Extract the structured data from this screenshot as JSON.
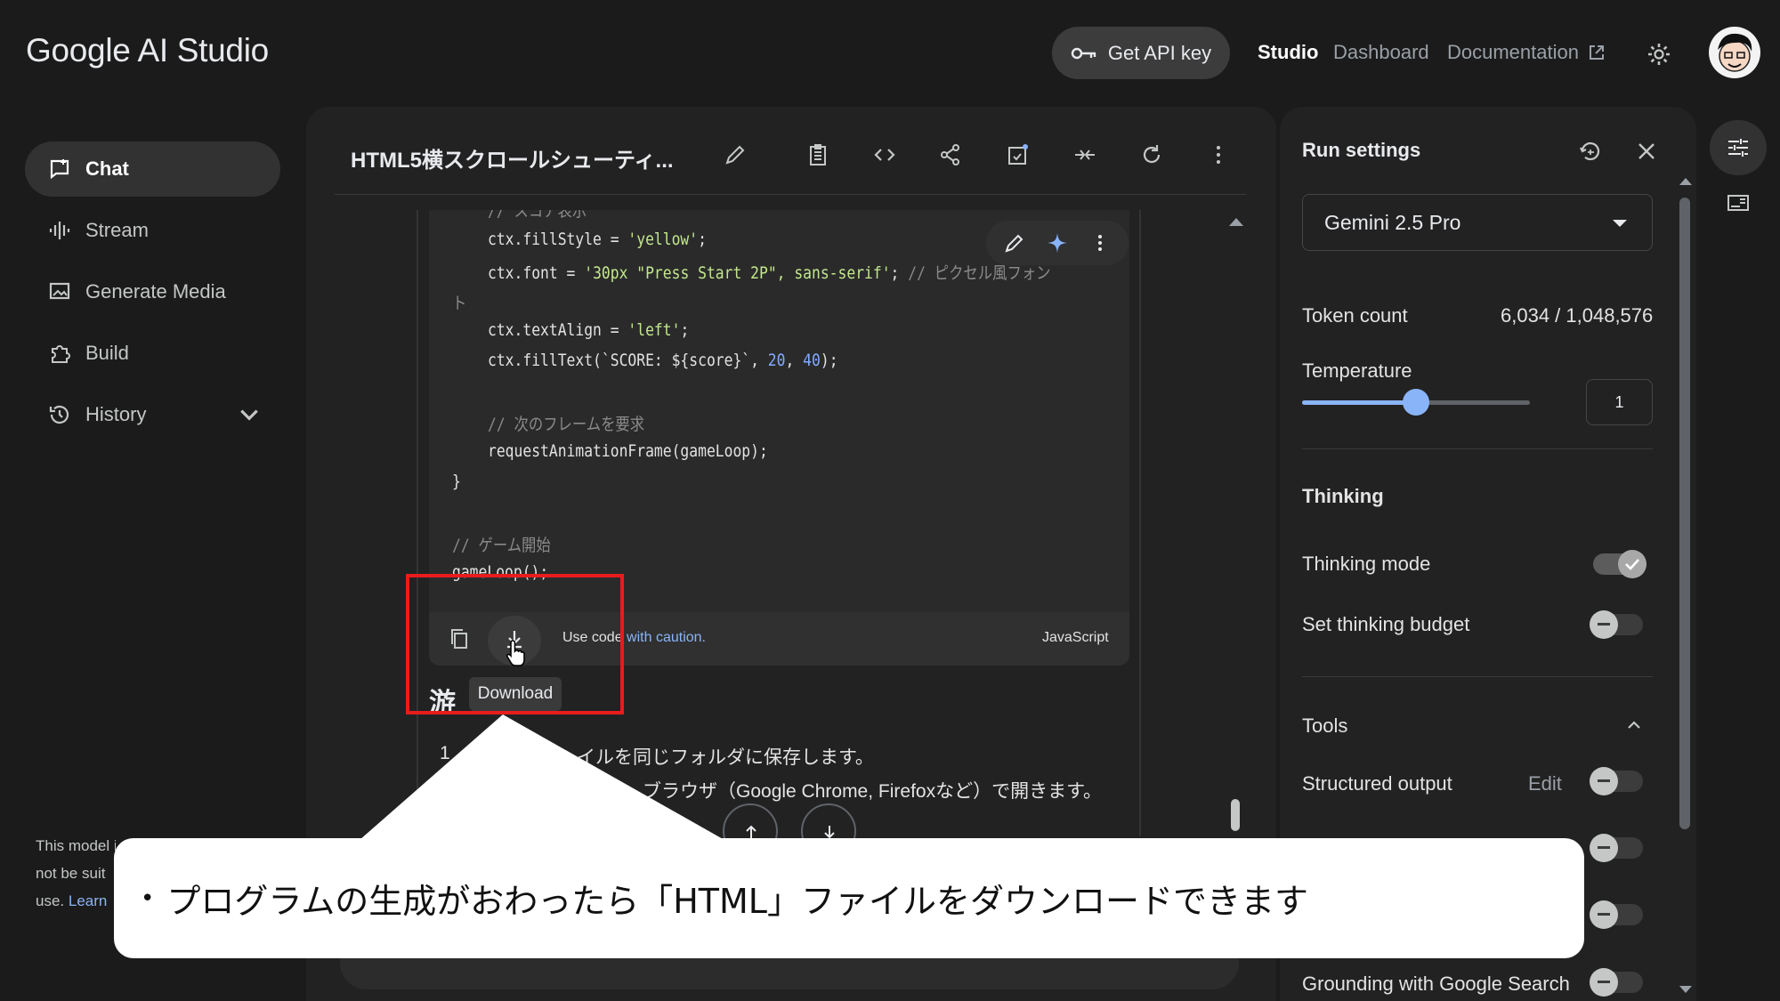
{
  "app": {
    "logo": "Google AI Studio"
  },
  "topbar": {
    "api_key_label": "Get API key",
    "nav": {
      "studio": "Studio",
      "dashboard": "Dashboard",
      "documentation": "Documentation"
    }
  },
  "sidebar": {
    "items": [
      {
        "label": "Chat",
        "icon": "chat-icon"
      },
      {
        "label": "Stream",
        "icon": "waveform-icon"
      },
      {
        "label": "Generate Media",
        "icon": "image-icon"
      },
      {
        "label": "Build",
        "icon": "puzzle-icon"
      },
      {
        "label": "History",
        "icon": "history-icon"
      }
    ],
    "disclaimer": {
      "line1": "This model i",
      "line2": "not be suit",
      "line3_prefix": "use. ",
      "learn": "Learn"
    }
  },
  "chat": {
    "title": "HTML5横スクロールシューティ...",
    "code": {
      "lines": [
        {
          "indent": "    ",
          "text": "ctx.fillStyle = ",
          "str": "'yellow'",
          "rest": ";"
        },
        {
          "indent": "    ",
          "text": "ctx.font = ",
          "str": "'30px \"Press Start 2P\", sans-serif'",
          "rest": "; ",
          "comment": "// ピクセル風フォン"
        },
        {
          "indent": "",
          "text": "ト"
        },
        {
          "indent": "    ",
          "text": "ctx.textAlign = ",
          "str": "'left'",
          "rest": ";"
        },
        {
          "indent": "    ",
          "text": "ctx.fillText(`SCORE: ${score}`, ",
          "num1": "20",
          "sep": ", ",
          "num2": "40",
          "rest": ");"
        },
        {
          "indent": "    ",
          "comment": "// 次のフレームを要求"
        },
        {
          "indent": "    ",
          "text": "requestAnimationFrame(gameLoop);"
        },
        {
          "indent": "",
          "text": "}"
        },
        {
          "indent": "",
          "comment": "// ゲーム開始"
        },
        {
          "indent": "",
          "text": "gameLoop();"
        }
      ],
      "partial_top": "// スコア表示",
      "footer": {
        "caution_prefix": "Use code ",
        "caution_link": "with caution.",
        "language": "JavaScript"
      },
      "tooltip": "Download"
    },
    "heading_partial": "游",
    "list": {
      "number": "1",
      "line1": "イルを同じフォルダに保存します。",
      "line2": "ブラウザ（Google Chrome, Firefoxなど）で開きます。"
    }
  },
  "run_settings": {
    "title": "Run settings",
    "model": "Gemini 2.5 Pro",
    "token_count_label": "Token count",
    "token_count_value": "6,034 / 1,048,576",
    "temperature_label": "Temperature",
    "temperature_value": "1",
    "temperature_fraction": 0.5,
    "thinking_header": "Thinking",
    "thinking_mode_label": "Thinking mode",
    "thinking_budget_label": "Set thinking budget",
    "tools_header": "Tools",
    "structured_output_label": "Structured output",
    "edit_label": "Edit",
    "grounding_label": "Grounding with Google Search"
  },
  "callout": {
    "text": "プログラムの生成がおわったら「HTML」ファイルをダウンロードできます"
  },
  "colors": {
    "accent": "#8ab4f8",
    "highlight_box": "#e81c1c",
    "background": "#1b1b1c"
  }
}
